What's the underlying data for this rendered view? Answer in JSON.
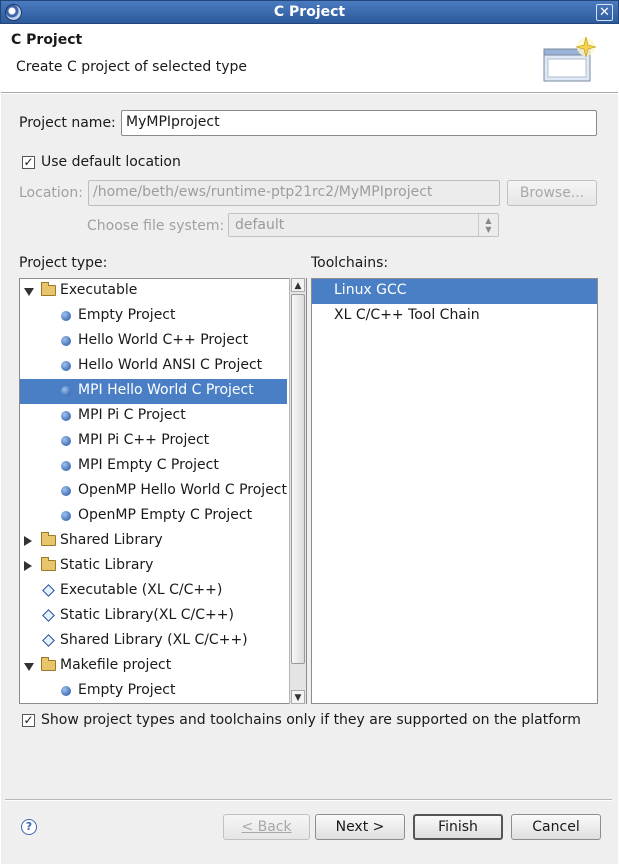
{
  "window": {
    "title": "C Project",
    "close_glyph": "✕"
  },
  "banner": {
    "heading": "C Project",
    "description": "Create C project of selected type"
  },
  "project_name": {
    "label": "Project name:",
    "value": "MyMPIproject"
  },
  "default_location": {
    "label": "Use default location",
    "checked": true
  },
  "location": {
    "label": "Location:",
    "value": "/home/beth/ews/runtime-ptp21rc2/MyMPIproject",
    "browse_label": "Browse..."
  },
  "file_system": {
    "label": "Choose file system:",
    "value": "default"
  },
  "project_type": {
    "label": "Project type:",
    "items": [
      {
        "label": "Executable",
        "icon": "folder-open-icon",
        "expander": "open",
        "level": 0
      },
      {
        "label": "Empty Project",
        "icon": "bullet-icon",
        "level": 1
      },
      {
        "label": "Hello World C++ Project",
        "icon": "bullet-icon",
        "level": 1
      },
      {
        "label": "Hello World ANSI C Project",
        "icon": "bullet-icon",
        "level": 1
      },
      {
        "label": "MPI Hello World C Project",
        "icon": "bullet-icon",
        "level": 1,
        "selected": true
      },
      {
        "label": "MPI Pi C Project",
        "icon": "bullet-icon",
        "level": 1
      },
      {
        "label": "MPI Pi C++ Project",
        "icon": "bullet-icon",
        "level": 1
      },
      {
        "label": "MPI Empty C Project",
        "icon": "bullet-icon",
        "level": 1
      },
      {
        "label": "OpenMP Hello World C Project",
        "icon": "bullet-icon",
        "level": 1
      },
      {
        "label": "OpenMP Empty C Project",
        "icon": "bullet-icon",
        "level": 1
      },
      {
        "label": "Shared Library",
        "icon": "folder-icon",
        "expander": "closed",
        "level": 0
      },
      {
        "label": "Static Library",
        "icon": "folder-icon",
        "expander": "closed",
        "level": 0
      },
      {
        "label": "Executable (XL C/C++)",
        "icon": "diamond-icon",
        "level": 0
      },
      {
        "label": "Static Library(XL C/C++)",
        "icon": "diamond-icon",
        "level": 0
      },
      {
        "label": "Shared Library (XL C/C++)",
        "icon": "diamond-icon",
        "level": 0
      },
      {
        "label": "Makefile project",
        "icon": "folder-open-icon",
        "expander": "open",
        "level": 0
      },
      {
        "label": "Empty Project",
        "icon": "bullet-icon",
        "level": 1
      }
    ]
  },
  "toolchains": {
    "label": "Toolchains:",
    "items": [
      {
        "label": "Linux GCC",
        "selected": true
      },
      {
        "label": "XL C/C++ Tool Chain"
      }
    ]
  },
  "supported_only": {
    "label": "Show project types and toolchains only if they are supported on the platform",
    "checked": true
  },
  "buttons": {
    "back": "< Back",
    "next": "Next >",
    "finish": "Finish",
    "cancel": "Cancel"
  },
  "help": {
    "glyph": "?"
  }
}
